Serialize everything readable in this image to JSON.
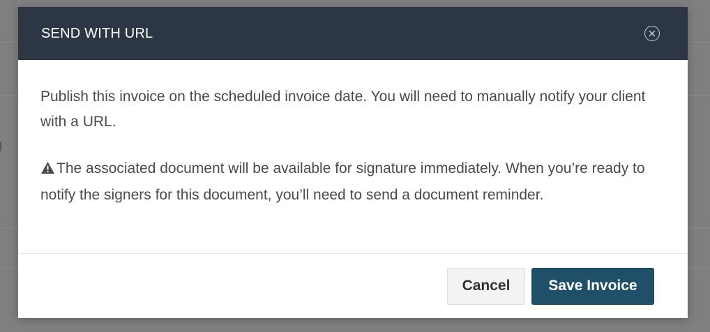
{
  "modal": {
    "title": "SEND WITH URL",
    "close_icon": "close-circle-icon",
    "body": {
      "paragraph_1": "Publish this invoice on the scheduled invoice date. You will need to manually notify your client with a URL.",
      "warning_icon": "warning-triangle-icon",
      "paragraph_2": "The associated document will be available for signature immediately. When you’re ready to notify the signers for this document, you’ll need to send a document reminder."
    },
    "footer": {
      "cancel_label": "Cancel",
      "save_label": "Save Invoice"
    }
  },
  "colors": {
    "header_bg": "#2c3644",
    "primary_button": "#1f5068",
    "overlay": "#7f7f7f"
  }
}
